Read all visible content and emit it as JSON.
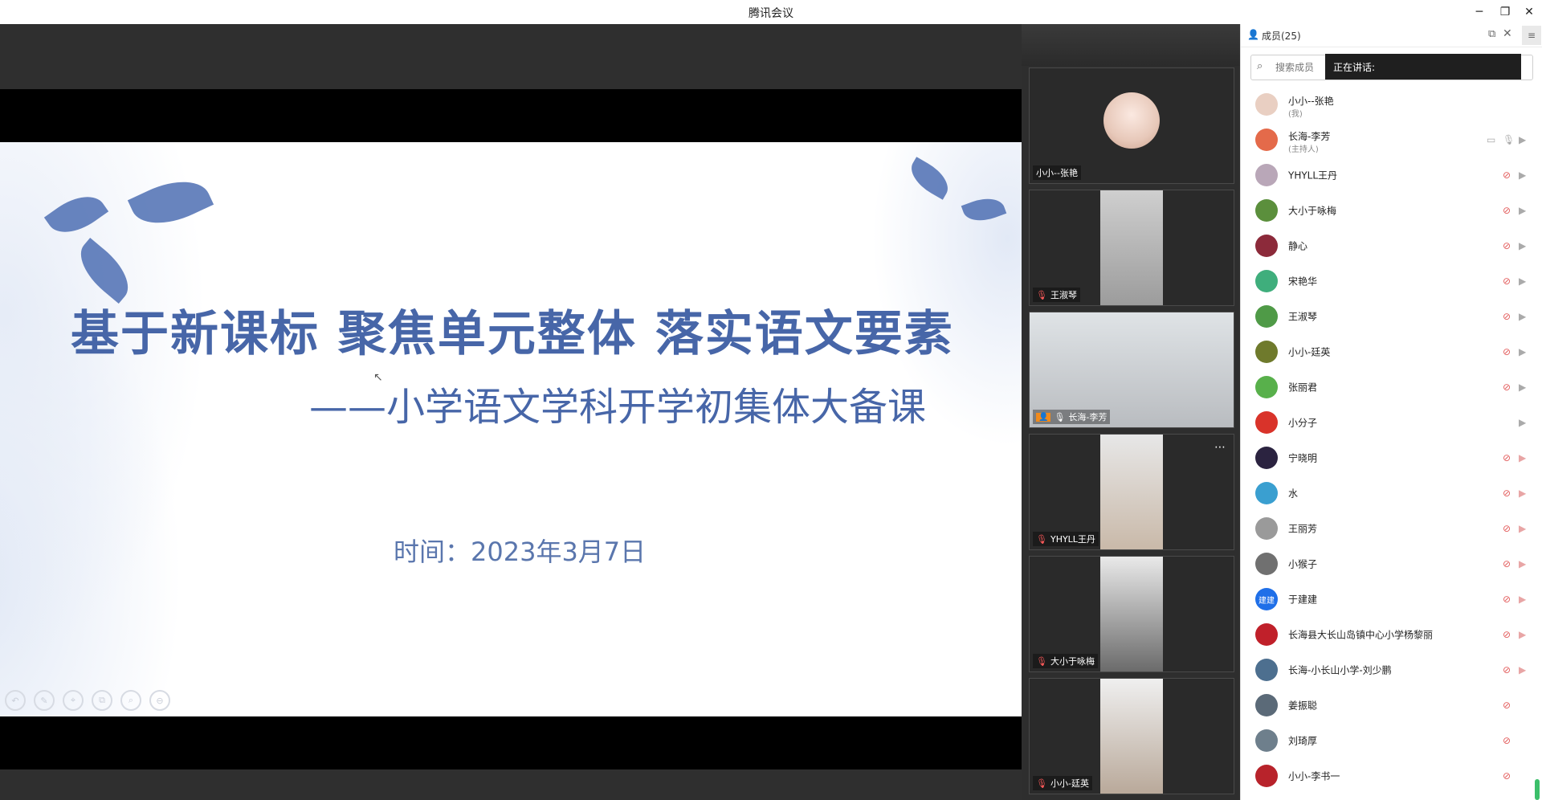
{
  "window": {
    "title": "腾讯会议",
    "min": "─",
    "max": "❐",
    "close": "✕"
  },
  "slide": {
    "title": "基于新课标 聚焦单元整体 落实语文要素",
    "subtitle": "——小学语文学科开学初集体大备课",
    "date": "时间：2023年3月7日"
  },
  "videos": [
    {
      "name": "小小--张艳",
      "mic": "none"
    },
    {
      "name": "王淑琴",
      "mic": "muted"
    },
    {
      "name": "长海-李芳",
      "mic": "on",
      "host": true
    },
    {
      "name": "YHYLL王丹",
      "mic": "muted"
    },
    {
      "name": "大小于咏梅",
      "mic": "muted"
    },
    {
      "name": "小小-廷英",
      "mic": "muted"
    }
  ],
  "panel": {
    "title": "成员(25)",
    "search_placeholder": "搜索成员",
    "speaking_label": "正在讲话:"
  },
  "members": [
    {
      "name": "小小--张艳",
      "role": "(我)",
      "color": "#e9cfc2",
      "mic": "",
      "cam": ""
    },
    {
      "name": "长海-李芳",
      "role": "(主持人)",
      "color": "#e46a4a",
      "mic": "on",
      "cam": "on",
      "screen": true
    },
    {
      "name": "YHYLL王丹",
      "color": "#b9a7b8",
      "mic": "off",
      "cam": "on"
    },
    {
      "name": "大小于咏梅",
      "color": "#5b8f3c",
      "mic": "off",
      "cam": "on"
    },
    {
      "name": "静心",
      "color": "#8c2a3a",
      "mic": "off",
      "cam": "on"
    },
    {
      "name": "宋艳华",
      "color": "#3fae7c",
      "mic": "off",
      "cam": "on"
    },
    {
      "name": "王淑琴",
      "color": "#4f9a47",
      "mic": "off",
      "cam": "on"
    },
    {
      "name": "小小-廷英",
      "color": "#6f7a2c",
      "mic": "off",
      "cam": "on"
    },
    {
      "name": "张丽君",
      "color": "#58b04b",
      "mic": "off",
      "cam": "on"
    },
    {
      "name": "小分子",
      "color": "#d9332a",
      "mic": "",
      "cam": "on"
    },
    {
      "name": "宁晓明",
      "color": "#2b2340",
      "mic": "off",
      "cam": "off"
    },
    {
      "name": "水",
      "color": "#3a9fd0",
      "mic": "off",
      "cam": "off"
    },
    {
      "name": "王丽芳",
      "color": "#9a9a9a",
      "mic": "off",
      "cam": "off"
    },
    {
      "name": "小猴子",
      "color": "#707070",
      "mic": "off",
      "cam": "off"
    },
    {
      "name": "于建建",
      "color": "#1f6fe8",
      "mic": "off",
      "cam": "off",
      "initials": "建建"
    },
    {
      "name": "长海县大长山岛镇中心小学杨黎丽",
      "color": "#c0202a",
      "mic": "off",
      "cam": "off"
    },
    {
      "name": "长海-小长山小学-刘少鹏",
      "color": "#4d6f8f",
      "mic": "off",
      "cam": "off"
    },
    {
      "name": "姜振聪",
      "color": "#5b6a78",
      "mic": "off",
      "cam": ""
    },
    {
      "name": "刘琦厚",
      "color": "#6e7f8c",
      "mic": "off",
      "cam": ""
    },
    {
      "name": "小小-李书一",
      "color": "#b8232b",
      "mic": "off",
      "cam": ""
    }
  ],
  "slide_tools": [
    "↶",
    "✎",
    "⌖",
    "⧉",
    "⌕",
    "⊖"
  ]
}
